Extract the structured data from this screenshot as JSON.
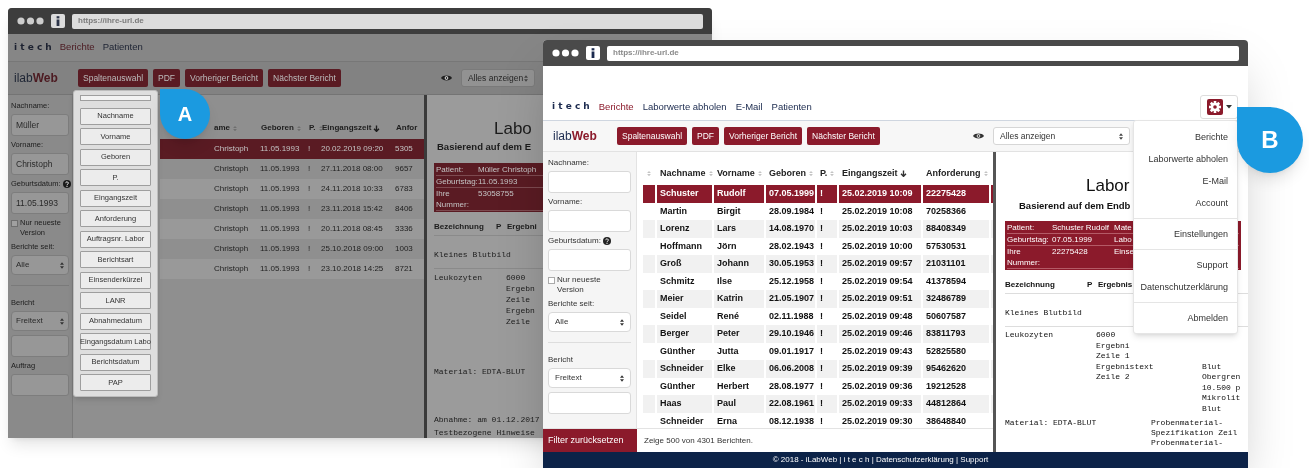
{
  "background_window": {
    "url": "https://ihre-url.de",
    "brand": "i t e c h",
    "nav": [
      {
        "label": "Berichte",
        "selected": true
      },
      {
        "label": "Patienten",
        "selected": false
      }
    ],
    "app_logo": {
      "first": "ilab",
      "second": "Web"
    },
    "toolbar_buttons": [
      "Spaltenauswahl",
      "PDF",
      "Vorheriger Bericht",
      "Nächster Bericht"
    ],
    "view_select": "Alles anzeigen",
    "sidebar": [
      {
        "kind": "field",
        "label": "Nachname:",
        "value": "Müller"
      },
      {
        "kind": "field",
        "label": "Vorname:",
        "value": "Christoph"
      },
      {
        "kind": "field",
        "label": "Geburtsdatum:",
        "value": "11.05.1993",
        "help": true
      },
      {
        "kind": "checkbox",
        "label": "Nur neueste Version",
        "checked": false
      },
      {
        "kind": "select",
        "label": "Berichte seit:",
        "value": "Alle"
      },
      {
        "kind": "select",
        "label": "Bericht",
        "value": "Freitext",
        "separated": true
      },
      {
        "kind": "field"
      },
      {
        "kind": "field",
        "label": "Auftrag"
      }
    ],
    "column_menu": [
      "Nachname",
      "Vorname",
      "Geboren",
      "P.",
      "Eingangszeit",
      "Anforderung",
      "Auftragsnr. Labor",
      "Berichtsart",
      "Einsenderkürzel",
      "LANR",
      "Abnahmedatum",
      "Eingangsdatum Labo",
      "Berichtsdatum",
      "PAP"
    ],
    "table": {
      "columns": [
        {
          "label": "ame",
          "sorted": false
        },
        {
          "label": "Geboren",
          "sorted": false
        },
        {
          "label": "P.",
          "sorted": false
        },
        {
          "label": "Eingangszeit",
          "sorted": true
        },
        {
          "label": "Anfor"
        }
      ],
      "rows": [
        {
          "cells": [
            "Christoph",
            "11.05.1993",
            "!",
            "20.02.2019 09:20",
            "5305"
          ],
          "selected": true
        },
        {
          "cells": [
            "Christoph",
            "11.05.1993",
            "!",
            "27.11.2018 08:00",
            "9657"
          ],
          "selected": false
        },
        {
          "cells": [
            "Christoph",
            "11.05.1993",
            "!",
            "24.11.2018 10:33",
            "6783"
          ],
          "selected": false
        },
        {
          "cells": [
            "Christoph",
            "11.05.1993",
            "!",
            "23.11.2018 15:42",
            "8406"
          ],
          "selected": false
        },
        {
          "cells": [
            "Christoph",
            "11.05.1993",
            "!",
            "20.11.2018 08:45",
            "3336"
          ],
          "selected": false
        },
        {
          "cells": [
            "Christoph",
            "11.05.1993",
            "!",
            "25.10.2018 09:00",
            "1003"
          ],
          "selected": false
        },
        {
          "cells": [
            "Christoph",
            "11.05.1993",
            "!",
            "23.10.2018 14:25",
            "8721"
          ],
          "selected": false
        }
      ]
    },
    "report": {
      "title": "Labo",
      "subtitle": "Basierend auf dem E",
      "patient_box": [
        {
          "label": "Patient:",
          "value": "Müller Christoph"
        },
        {
          "label": "Geburtstag:",
          "value": "11.05.1993"
        },
        {
          "label": "Ihre Nummer:",
          "value": "53058755"
        }
      ],
      "result_header": [
        "Bezeichnung",
        "P",
        "Ergebni"
      ],
      "section": "Kleines Blutbild",
      "results": [
        {
          "name": "Leukozyten",
          "result": [
            "6000",
            "Ergebn",
            "Zeile",
            "Ergebn",
            "Zeile"
          ]
        }
      ],
      "material": "Material: EDTA-BLUT",
      "notes": [
        "Abnahme: am 01.12.2017",
        "Testbezogene Hinweise"
      ]
    }
  },
  "front_window": {
    "url": "https://ihre-url.de",
    "brand": "i t e c h",
    "nav": [
      {
        "label": "Berichte",
        "selected": true
      },
      {
        "label": "Laborwerte abholen",
        "selected": false
      },
      {
        "label": "E-Mail",
        "selected": false
      },
      {
        "label": "Patienten",
        "selected": false
      }
    ],
    "app_logo": {
      "first": "ilab",
      "second": "Web"
    },
    "toolbar_buttons": [
      "Spaltenauswahl",
      "PDF",
      "Vorheriger Bericht",
      "Nächster Bericht"
    ],
    "view_select": "Alles anzeigen",
    "sidebar": [
      {
        "kind": "field",
        "label": "Nachname:"
      },
      {
        "kind": "field",
        "label": "Vorname:"
      },
      {
        "kind": "field",
        "label": "Geburtsdatum:",
        "help": true
      },
      {
        "kind": "checkbox",
        "label": "Nur neueste Version",
        "checked": false
      },
      {
        "kind": "select",
        "label": "Berichte seit:",
        "value": "Alle"
      },
      {
        "kind": "select",
        "label": "Bericht",
        "value": "Freitext",
        "separated": true
      },
      {
        "kind": "field"
      }
    ],
    "table": {
      "columns": [
        {
          "sorted": false
        },
        {
          "label": "Nachname",
          "sorted": false
        },
        {
          "label": "Vorname",
          "sorted": false
        },
        {
          "label": "Geboren",
          "sorted": false
        },
        {
          "label": "P.",
          "sorted": false
        },
        {
          "label": "Eingangszeit",
          "sorted": true
        },
        {
          "label": "Anforderung",
          "sorted": false
        }
      ],
      "rows": [
        {
          "cells": [
            "",
            "Schuster",
            "Rudolf",
            "07.05.1999",
            "!",
            "25.02.2019 10:09",
            "22275428"
          ],
          "selected": true
        },
        {
          "cells": [
            "",
            "Martin",
            "Birgit",
            "28.09.1984",
            "!",
            "25.02.2019 10:08",
            "70258366"
          ],
          "selected": false
        },
        {
          "cells": [
            "",
            "Lorenz",
            "Lars",
            "14.08.1970",
            "!",
            "25.02.2019 10:03",
            "88408349"
          ],
          "selected": false
        },
        {
          "cells": [
            "",
            "Hoffmann",
            "Jörn",
            "28.02.1943",
            "!",
            "25.02.2019 10:00",
            "57530531"
          ],
          "selected": false
        },
        {
          "cells": [
            "",
            "Groß",
            "Johann",
            "30.05.1953",
            "!",
            "25.02.2019 09:57",
            "21031101"
          ],
          "selected": false
        },
        {
          "cells": [
            "",
            "Schmitz",
            "Ilse",
            "25.12.1958",
            "!",
            "25.02.2019 09:54",
            "41378594"
          ],
          "selected": false
        },
        {
          "cells": [
            "",
            "Meier",
            "Katrin",
            "21.05.1907",
            "!",
            "25.02.2019 09:51",
            "32486789"
          ],
          "selected": false
        },
        {
          "cells": [
            "",
            "Seidel",
            "René",
            "02.11.1988",
            "!",
            "25.02.2019 09:48",
            "50607587"
          ],
          "selected": false
        },
        {
          "cells": [
            "",
            "Berger",
            "Peter",
            "29.10.1946",
            "!",
            "25.02.2019 09:46",
            "83811793"
          ],
          "selected": false
        },
        {
          "cells": [
            "",
            "Günther",
            "Jutta",
            "09.01.1917",
            "!",
            "25.02.2019 09:43",
            "52825580"
          ],
          "selected": false
        },
        {
          "cells": [
            "",
            "Schneider",
            "Elke",
            "06.06.2008",
            "!",
            "25.02.2019 09:39",
            "95462620"
          ],
          "selected": false
        },
        {
          "cells": [
            "",
            "Günther",
            "Herbert",
            "28.08.1977",
            "!",
            "25.02.2019 09:36",
            "19212528"
          ],
          "selected": false
        },
        {
          "cells": [
            "",
            "Haas",
            "Paul",
            "22.08.1961",
            "!",
            "25.02.2019 09:33",
            "44812864"
          ],
          "selected": false
        },
        {
          "cells": [
            "",
            "Schneider",
            "Erna",
            "08.12.1938",
            "!",
            "25.02.2019 09:30",
            "38648840"
          ],
          "selected": false
        }
      ]
    },
    "reset_button": "Filter zurücksetzen",
    "result_count": "Zeige 500 von 4301 Berichten.",
    "report": {
      "title": "Labor",
      "subtitle": "Basierend auf dem Endb",
      "patient_box": [
        {
          "label": "Patient:",
          "value": "Schuster Rudolf",
          "extra": "Mate"
        },
        {
          "label": "Geburtstag:",
          "value": "07.05.1999",
          "extra": "Labo"
        },
        {
          "label": "Ihre Nummer:",
          "value": "22275428",
          "extra": "Einse"
        }
      ],
      "result_header": [
        "Bezeichnung",
        "P",
        "Ergebnis"
      ],
      "section": "Kleines Blutbild",
      "results": [
        {
          "name": "Leukozyten",
          "result": [
            "6000",
            "Ergebni",
            "Zeile 1",
            "Ergebnistext",
            "Zeile 2"
          ],
          "reference": [
            "Blut",
            "Obergren",
            "10.500 p",
            "Mikrolit",
            "Blut"
          ]
        }
      ],
      "material": "Material: EDTA-BLUT",
      "material_notes": [
        "Probenmaterial-",
        "Spezifikation Zeil",
        "Probenmaterial-"
      ]
    },
    "settings_menu": {
      "open": true,
      "groups": [
        [
          "Berichte",
          "Laborwerte abholen",
          "E-Mail",
          "Account"
        ],
        [
          "Einstellungen"
        ],
        [
          "Support",
          "Datenschutzerklärung"
        ],
        [
          "Abmelden"
        ]
      ]
    },
    "footer": "© 2018 - iLabWeb | i t e c h | Datenschutzerklärung | Support"
  },
  "callouts": [
    "A",
    "B"
  ]
}
